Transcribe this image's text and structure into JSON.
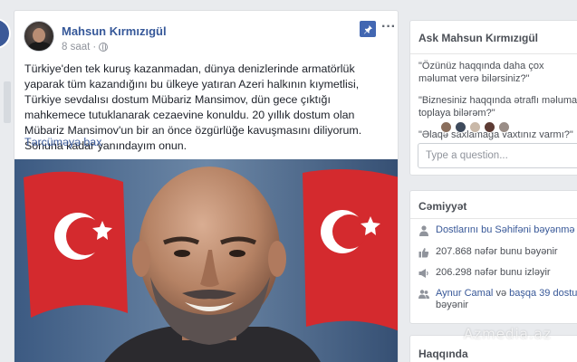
{
  "post": {
    "author": "Mahsun Kırmızıgül",
    "time": "8 saat",
    "text": "Türkiye'den tek kuruş kazanmadan, dünya denizlerinde armatörlük yaparak tüm kazandığını bu ülkeye yatıran Azeri halkının kıymetlisi, Türkiye sevdalısı dostum Mübariz Mansimov, dün gece çıktığı mahkemece tutuklanarak cezaevine konuldu. 20 yıllık dostum olan Mübariz Mansimov'un bir an önce özgürlüğe kavuşmasını diliyorum. Sonuna kadar yanındayım onun.",
    "translate_link": "Tərcüməyə bax",
    "icons": {
      "pin": "pin-icon",
      "more": "more-options-icon",
      "audience": "globe-icon"
    }
  },
  "ask": {
    "title": "Ask Mahsun Kırmızıgül",
    "questions": [
      "\"Özünüz haqqında daha çox məlumat verə bilərsiniz?\"",
      "\"Biznesiniz haqqında ətraflı məlumat toplaya bilərəm?\"",
      "\"Əlaqə saxlamağa vaxtınız varmı?\""
    ],
    "input_placeholder": "Type a question..."
  },
  "community": {
    "title": "Cəmiyyət",
    "invite": "Dostlarını bu Səhifəni bəyənmə",
    "likes": "207.868 nəfər bunu bəyənir",
    "follows": "206.298 nəfər bunu izləyir",
    "friends_name": "Aynur Camal",
    "friends_others": "başqa 39 dostu",
    "friends_and": "və",
    "friends_suffix": "bəyənir"
  },
  "about": {
    "title": "Haqqında"
  },
  "watermark": "Azmedia.az",
  "colors": {
    "link": "#385898",
    "brand": "#4267b2",
    "background": "#e9ebee"
  }
}
